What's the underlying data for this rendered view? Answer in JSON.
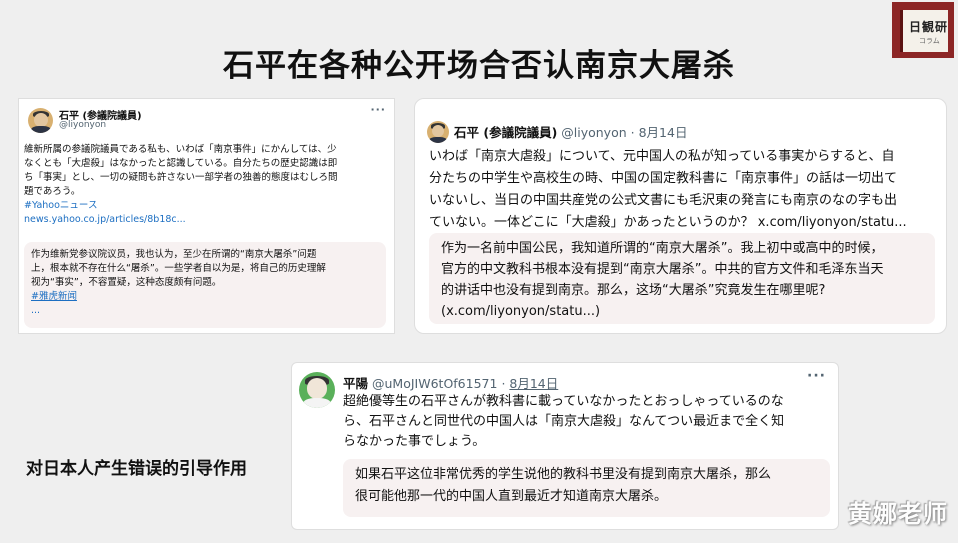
{
  "slide": {
    "title": "石平在各种公开场合否认南京大屠杀",
    "annotation": "对日本人产生错误的引导作用",
    "watermark": "黄娜老师"
  },
  "logo": {
    "title": "日観研",
    "subtitle": "コラム"
  },
  "tweet1": {
    "name": "石平 (参議院議員)",
    "handle": "@liyonyon",
    "more": "···",
    "body_lines": [
      "維新所属の参議院議員である私も、いわば「南京事件」にかんしては、少",
      "なくとも「大虐殺」はなかったと認識している。自分たちの歴史認識は即",
      "ち「事実」とし、一切の疑問も許さない一部学者の独善的態度はむしろ問",
      "題であろう。"
    ],
    "hashtag": "#Yahooニュース",
    "url": "news.yahoo.co.jp/articles/8b18c...",
    "translation_lines": [
      "作为维新党参议院议员，我也认为，至少在所谓的“南京大屠杀”问题",
      "上，根本就不存在什么“屠杀”。一些学者自以为是，将自己的历史理解",
      "视为“事实”，不容置疑，这种态度颇有问题。"
    ],
    "translation_hashtag": "#雅虎新闻",
    "translation_more": "..."
  },
  "tweet2": {
    "name": "石平 (参議院議員)",
    "handle": "@liyonyon",
    "date": "· 8月14日",
    "body_lines": [
      "いわば「南京大虐殺」について、元中国人の私が知っている事実からすると、自",
      "分たちの中学生や高校生の時、中国の国定教科書に「南京事件」の話は一切出て",
      "いないし、当日の中国共産党の公式文書にも毛沢東の発言にも南京のなの字も出",
      "ていない。一体どこに「大虐殺」かあったというのか？ x.com/liyonyon/statu..."
    ],
    "translation_lines": [
      "作为一名前中国公民，我知道所谓的“南京大屠杀”。我上初中或高中的时候，",
      "官方的中文教科书根本没有提到“南京大屠杀”。中共的官方文件和毛泽东当天",
      "的讲话中也没有提到南京。那么，这场“大屠杀”究竟发生在哪里呢?",
      "(x.com/liyonyon/statu...)"
    ]
  },
  "tweet3": {
    "name": "平陽",
    "handle": "@uMoJIW6tOf61571",
    "date": "8月14日",
    "more": "···",
    "body_lines": [
      "超絶優等生の石平さんが教科書に載っていなかったとおっしゃっているのな",
      "ら、石平さんと同世代の中国人は「南京大虐殺」なんてつい最近まで全く知",
      "らなかった事でしょう。"
    ],
    "translation_lines": [
      "如果石平这位非常优秀的学生说他的教科书里没有提到南京大屠杀，那么",
      "很可能他那一代的中国人直到最近才知道南京大屠杀。"
    ]
  }
}
